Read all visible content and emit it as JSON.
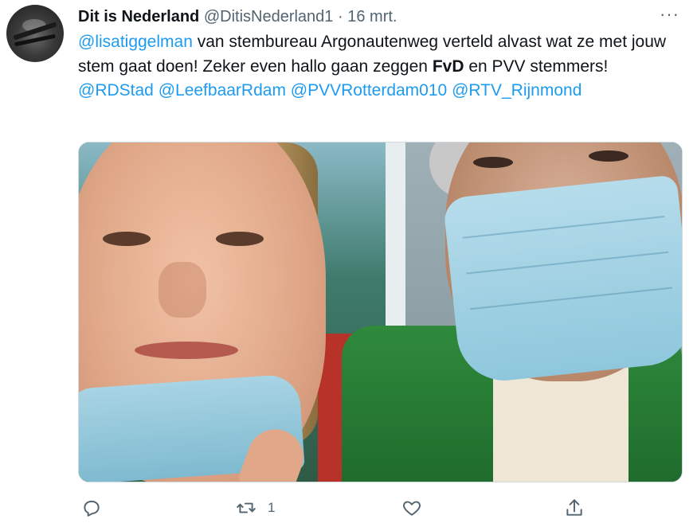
{
  "tweet": {
    "author_name": "Dit is Nederland",
    "author_handle": "@DitisNederland1",
    "separator": "·",
    "date": "16 mrt.",
    "more_label": "···",
    "text_parts": {
      "mention1": "@lisatiggelman",
      "t1": " van stembureau Argonautenweg verteld alvast wat ze met jouw stem gaat doen! Zeker even hallo gaan zeggen ",
      "bold1": "FvD",
      "t2": " en PVV stemmers! ",
      "mention2": "@RDStad",
      "sp1": " ",
      "mention3": "@LeefbaarRdam",
      "sp2": " ",
      "mention4": "@PVVRotterdam010",
      "sp3": " ",
      "mention5": "@RTV_Rijnmond"
    }
  },
  "actions": {
    "reply_icon": "reply-icon",
    "retweet_icon": "retweet-icon",
    "retweet_count": "1",
    "like_icon": "heart-icon",
    "share_icon": "share-icon"
  },
  "colors": {
    "link": "#1d9bf0",
    "muted": "#536471",
    "text": "#0f1419"
  }
}
